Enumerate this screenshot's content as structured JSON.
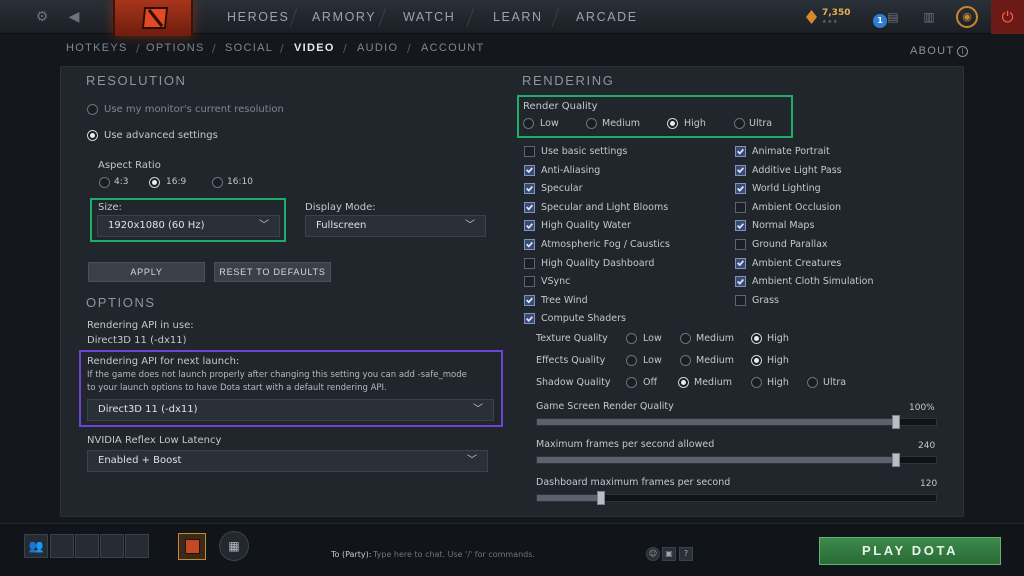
{
  "topbar": {
    "nav": [
      "HEROES",
      "ARMORY",
      "WATCH",
      "LEARN",
      "ARCADE"
    ],
    "shards": "7,350",
    "notifications": "1",
    "icons": [
      "gear-icon",
      "back-arrow-icon",
      "dota-logo-icon",
      "shards-icon",
      "inbox-icon",
      "armory-icon",
      "dashboard-settings-icon",
      "power-icon"
    ]
  },
  "subtabs": {
    "items": [
      "HOTKEYS",
      "OPTIONS",
      "SOCIAL",
      "VIDEO",
      "AUDIO",
      "ACCOUNT"
    ],
    "active": "VIDEO",
    "about": "ABOUT"
  },
  "resolution": {
    "title": "RESOLUTION",
    "monitor_res": "Use my monitor's current resolution",
    "advanced": "Use advanced settings",
    "aspect_label": "Aspect Ratio",
    "aspect_options": [
      "4:3",
      "16:9",
      "16:10"
    ],
    "aspect_selected": "16:9",
    "size_label": "Size:",
    "size_value": "1920x1080 (60 Hz)",
    "display_label": "Display Mode:",
    "display_value": "Fullscreen",
    "apply": "APPLY",
    "reset": "RESET TO DEFAULTS"
  },
  "options": {
    "title": "OPTIONS",
    "api_in_use_label": "Rendering API in use:",
    "api_in_use_value": "Direct3D 11 (-dx11)",
    "api_next_label": "Rendering API for next launch:",
    "api_next_desc1": "If the game does not launch properly after changing this setting you can add -safe_mode",
    "api_next_desc2": "to your launch options to have Dota start with a default rendering API.",
    "api_next_value": "Direct3D 11 (-dx11)",
    "reflex_label": "NVIDIA Reflex Low Latency",
    "reflex_value": "Enabled + Boost"
  },
  "rendering": {
    "title": "RENDERING",
    "quality_label": "Render Quality",
    "quality_options": [
      "Low",
      "Medium",
      "High",
      "Ultra"
    ],
    "quality_selected": "High",
    "checks_left": [
      {
        "label": "Use basic settings",
        "on": false
      },
      {
        "label": "Anti-Aliasing",
        "on": true
      },
      {
        "label": "Specular",
        "on": true
      },
      {
        "label": "Specular and Light Blooms",
        "on": true
      },
      {
        "label": "High Quality Water",
        "on": true
      },
      {
        "label": "Atmospheric Fog / Caustics",
        "on": true
      },
      {
        "label": "High Quality Dashboard",
        "on": false
      },
      {
        "label": "VSync",
        "on": false
      },
      {
        "label": "Tree Wind",
        "on": true
      },
      {
        "label": "Compute Shaders",
        "on": true
      }
    ],
    "checks_right": [
      {
        "label": "Animate Portrait",
        "on": true
      },
      {
        "label": "Additive Light Pass",
        "on": true
      },
      {
        "label": "World Lighting",
        "on": true
      },
      {
        "label": "Ambient Occlusion",
        "on": false
      },
      {
        "label": "Normal Maps",
        "on": true
      },
      {
        "label": "Ground Parallax",
        "on": false
      },
      {
        "label": "Ambient Creatures",
        "on": true
      },
      {
        "label": "Ambient Cloth Simulation",
        "on": true
      },
      {
        "label": "Grass",
        "on": false
      }
    ],
    "texture_label": "Texture Quality",
    "texture_options": [
      "Low",
      "Medium",
      "High"
    ],
    "texture_selected": "High",
    "effects_label": "Effects Quality",
    "effects_options": [
      "Low",
      "Medium",
      "High"
    ],
    "effects_selected": "High",
    "shadow_label": "Shadow Quality",
    "shadow_options": [
      "Off",
      "Medium",
      "High",
      "Ultra"
    ],
    "shadow_selected": "Medium",
    "screen_quality_label": "Game Screen Render Quality",
    "screen_quality_value": "100%",
    "screen_quality_fraction": 0.9,
    "max_fps_label": "Maximum frames per second allowed",
    "max_fps_value": "240",
    "max_fps_fraction": 0.9,
    "dash_fps_label": "Dashboard maximum frames per second",
    "dash_fps_value": "120",
    "dash_fps_fraction": 0.16
  },
  "bottombar": {
    "chat_to": "To (Party):",
    "chat_placeholder": "Type here to chat. Use '/' for commands.",
    "help": "?",
    "play": "PLAY DOTA"
  },
  "colors": {
    "highlight_green": "#1fae6a",
    "highlight_purple": "#6d44d6",
    "play_green": "#3c8a4a"
  }
}
